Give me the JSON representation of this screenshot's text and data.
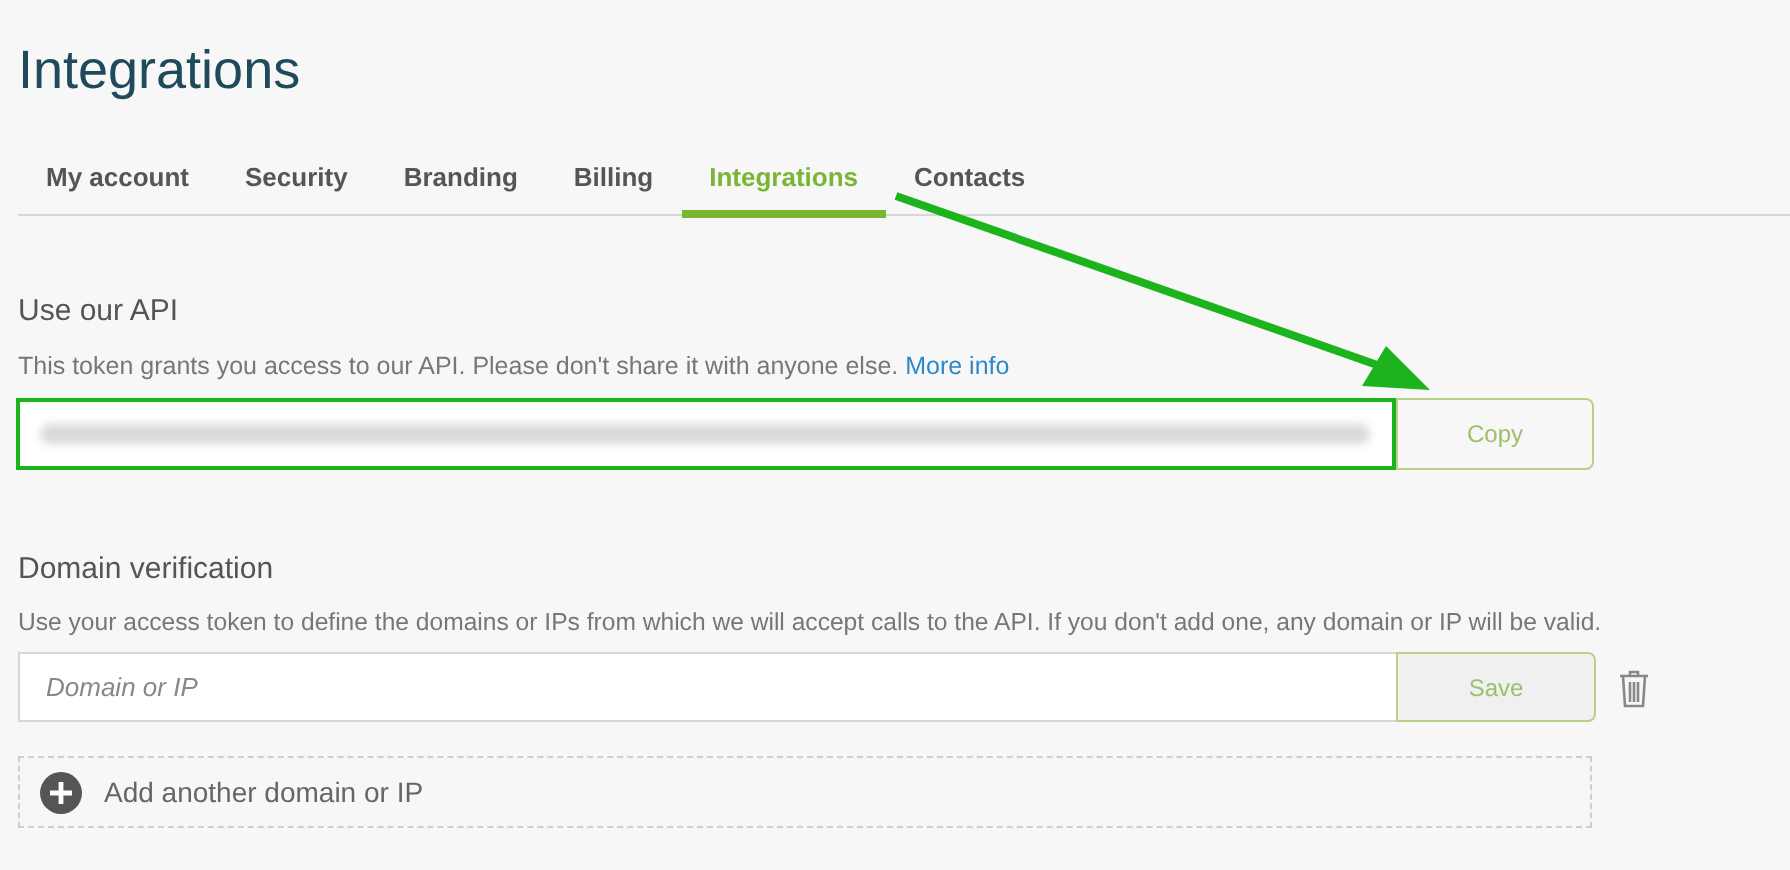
{
  "page_title": "Integrations",
  "tabs": [
    {
      "label": "My account",
      "selected": false
    },
    {
      "label": "Security",
      "selected": false
    },
    {
      "label": "Branding",
      "selected": false
    },
    {
      "label": "Billing",
      "selected": false
    },
    {
      "label": "Integrations",
      "selected": true
    },
    {
      "label": "Contacts",
      "selected": false
    }
  ],
  "api_section": {
    "heading": "Use our API",
    "description": "This token grants you access to our API. Please don't share it with anyone else.",
    "link": "More info",
    "token_highlighted": true,
    "copy_button": "Copy"
  },
  "domain_section": {
    "heading": "Domain verification",
    "description": "Use your access token to define the domains or IPs from which we will accept calls to the API. If you don't add one, any domain or IP will be valid.",
    "placeholder": "Domain or IP",
    "save_button": "Save",
    "add_label": "Add another domain or IP"
  }
}
